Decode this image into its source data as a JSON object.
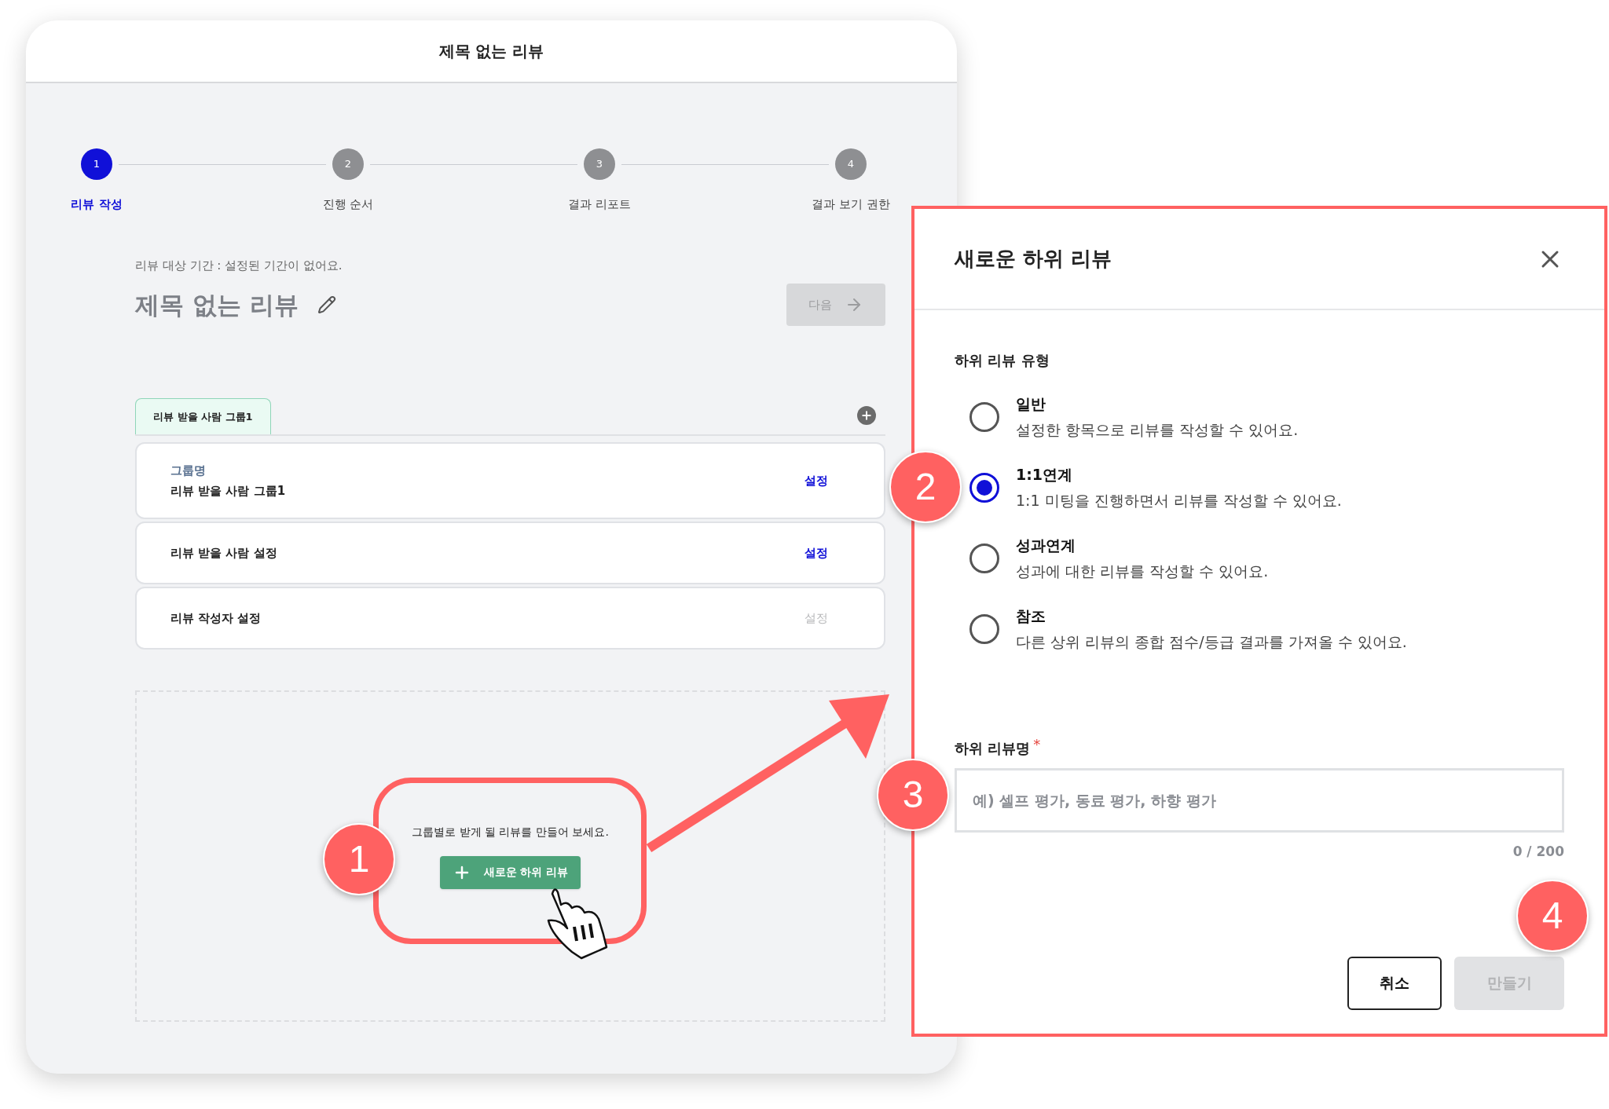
{
  "window": {
    "title": "제목 없는 리뷰"
  },
  "stepper": [
    {
      "number": "1",
      "label": "리뷰 작성",
      "selected": true
    },
    {
      "number": "2",
      "label": "진행 순서",
      "selected": false
    },
    {
      "number": "3",
      "label": "결과 리포트",
      "selected": false
    },
    {
      "number": "4",
      "label": "결과 보기 권한",
      "selected": false
    }
  ],
  "period_text": "리뷰 대상 기간 : 설정된 기간이 없어요.",
  "review_title": "제목 없는 리뷰",
  "next_button": {
    "label": "다음",
    "disabled": true
  },
  "group_tabs": [
    {
      "label": "리뷰 받을 사람 그룹1",
      "selected": true
    }
  ],
  "settings": [
    {
      "caption": "그룹명",
      "label": "리뷰 받을 사람 그룹1",
      "action": "설정",
      "disabled": false
    },
    {
      "label": "리뷰 받을 사람 설정",
      "action": "설정",
      "disabled": false
    },
    {
      "label": "리뷰 작성자 설정",
      "action": "설정",
      "disabled": true
    }
  ],
  "empty_state": {
    "message": "그룹별로 받게 될 리뷰를 만들어 보세요.",
    "button": "새로운 하위 리뷰"
  },
  "dialog": {
    "title": "새로운 하위 리뷰",
    "type_label": "하위 리뷰 유형",
    "options": [
      {
        "label": "일반",
        "description": "설정한 항목으로 리뷰를 작성할 수 있어요.",
        "selected": false
      },
      {
        "label": "1:1연계",
        "description": "1:1 미팅을 진행하면서 리뷰를 작성할 수 있어요.",
        "selected": true
      },
      {
        "label": "성과연계",
        "description": "성과에 대한 리뷰를 작성할 수 있어요.",
        "selected": false
      },
      {
        "label": "참조",
        "description": "다른 상위 리뷰의 종합 점수/등급 결과를 가져올 수 있어요.",
        "selected": false
      }
    ],
    "name_label": "하위 리뷰명",
    "required_mark": "*",
    "placeholder": "예) 셀프 평가, 동료 평가, 하향 평가",
    "counter": "0 / 200",
    "cancel": "취소",
    "create": {
      "label": "만들기",
      "disabled": true
    }
  },
  "callouts": [
    "1",
    "2",
    "3",
    "4"
  ]
}
